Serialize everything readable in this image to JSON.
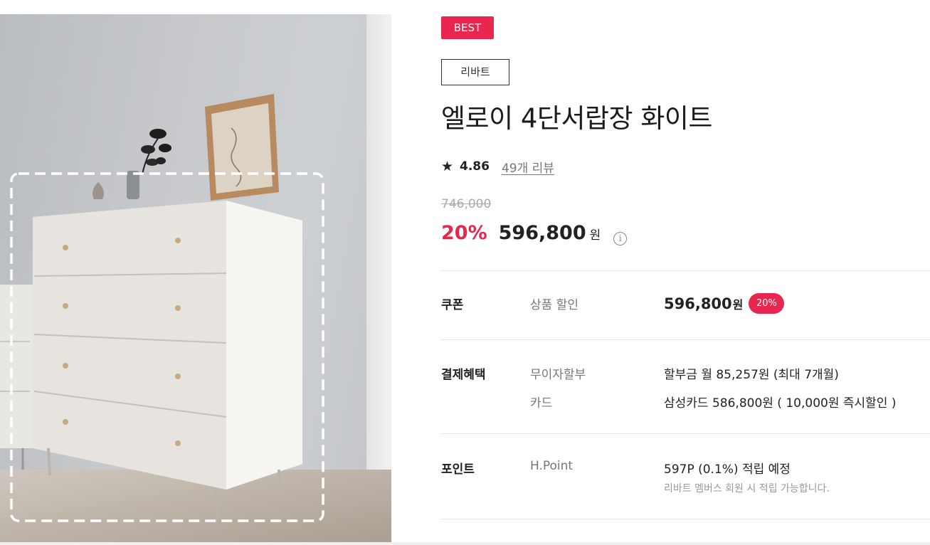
{
  "product_image": {
    "alt": "엘로이 4단서랍장 화이트"
  },
  "badge": "BEST",
  "brand": "리바트",
  "title": "엘로이 4단서랍장 화이트",
  "rating": {
    "score": "4.86",
    "reviews": "49개 리뷰",
    "icon": "star-icon"
  },
  "pricing": {
    "original": "746,000",
    "discount_rate": "20%",
    "price": "596,800",
    "currency": "원",
    "info_icon": "info-circle-icon"
  },
  "coupon": {
    "label": "쿠폰",
    "type": "상품 할인",
    "amount": "596,800",
    "currency": "원",
    "rate": "20%"
  },
  "payment": {
    "label": "결제혜택",
    "items": [
      {
        "type": "무이자할부",
        "value": "할부금 월 85,257원 (최대 7개월)"
      },
      {
        "type": "카드",
        "value": "삼성카드 586,800원 ( 10,000원 즉시할인 )"
      }
    ]
  },
  "point": {
    "label": "포인트",
    "type": "H.Point",
    "value": "597P (0.1%) 적립 예정",
    "note": "리바트 멤버스 회원 시 적립 가능합니다."
  },
  "colors": {
    "accent": "#e8264f",
    "text": "#222222",
    "muted": "#777777"
  }
}
